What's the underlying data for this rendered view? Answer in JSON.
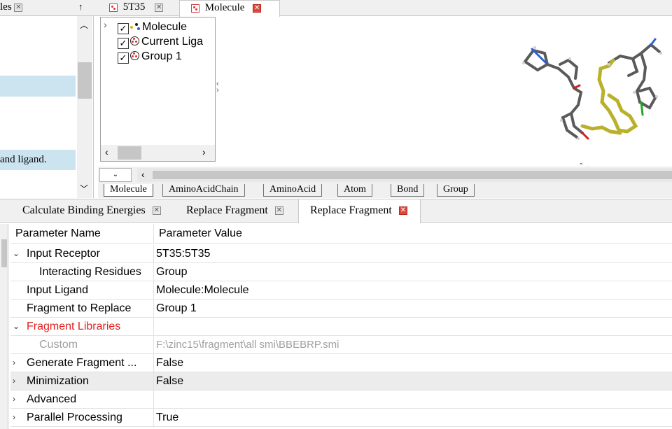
{
  "top_tabs": {
    "left_partial": "les",
    "pin_glyph": "↑",
    "tab1": "5T35",
    "tab2": "Molecule"
  },
  "left_panel": {
    "line_text": "and ligand."
  },
  "tree": {
    "items": [
      {
        "label": "Molecule",
        "checked": true,
        "icon": "molecule-icon"
      },
      {
        "label": "Current Liga",
        "checked": true,
        "icon": "ligand-icon"
      },
      {
        "label": "Group 1",
        "checked": true,
        "icon": "group-icon"
      }
    ]
  },
  "viewer_tabs": [
    "Molecule",
    "AminoAcidChain",
    "AminoAcid",
    "Atom",
    "Bond",
    "Group"
  ],
  "param_tabs": {
    "tab1": "Calculate Binding Energies",
    "tab2": "Replace Fragment",
    "tab3": "Replace Fragment"
  },
  "table": {
    "header_name": "Parameter Name",
    "header_value": "Parameter Value",
    "rows": [
      {
        "name": "Input Receptor",
        "value": "5T35:5T35"
      },
      {
        "name": "Interacting Residues",
        "value": "Group"
      },
      {
        "name": "Input Ligand",
        "value": "Molecule:Molecule"
      },
      {
        "name": "Fragment to Replace",
        "value": "Group 1"
      },
      {
        "name": "Fragment Libraries",
        "value": ""
      },
      {
        "name": "Custom",
        "value": "F:\\zinc15\\fragment\\all smi\\BBEBRP.smi"
      },
      {
        "name": "Generate Fragment ...",
        "value": "False"
      },
      {
        "name": "Minimization",
        "value": "False"
      },
      {
        "name": "Advanced",
        "value": ""
      },
      {
        "name": "Parallel Processing",
        "value": "True"
      }
    ]
  },
  "colors": {
    "selection": "#cce4f0",
    "accent_red": "#e02020",
    "ligand_yellow": "#b9b12a",
    "bond_gray": "#555555"
  }
}
